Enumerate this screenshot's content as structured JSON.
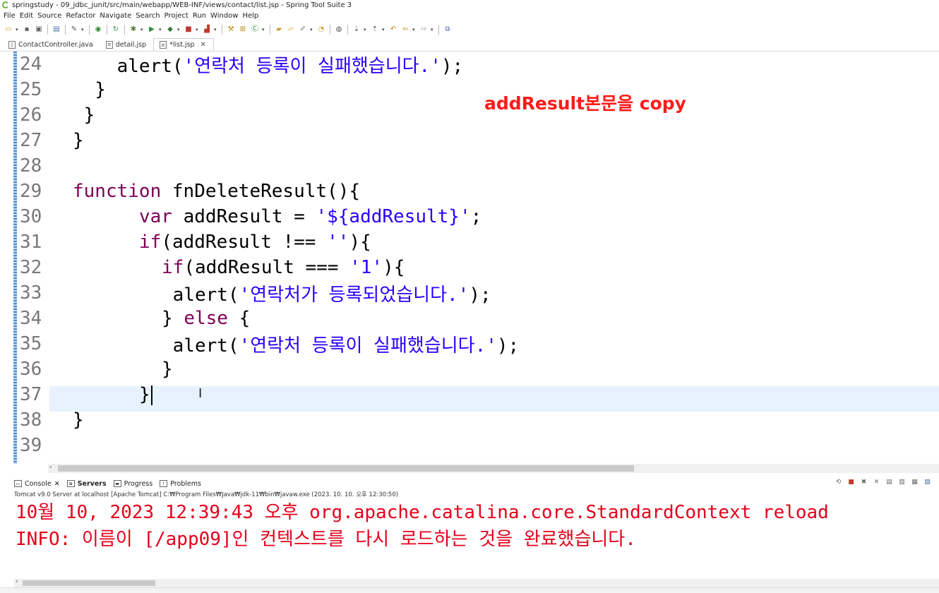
{
  "window": {
    "title": "springstudy - 09_jdbc_junit/src/main/webapp/WEB-INF/views/contact/list.jsp - Spring Tool Suite 3"
  },
  "menu": [
    "File",
    "Edit",
    "Source",
    "Refactor",
    "Navigate",
    "Search",
    "Project",
    "Run",
    "Window",
    "Help"
  ],
  "tabs": [
    {
      "label": "ContactController.java",
      "icon": "java-file-icon"
    },
    {
      "label": "detail.jsp",
      "icon": "jsp-file-icon"
    },
    {
      "label": "*list.jsp",
      "icon": "jsp-file-icon",
      "active": true
    }
  ],
  "editor": {
    "lines": [
      {
        "n": "24",
        "text": "      alert('연락처 등록이 실패했습니다.');"
      },
      {
        "n": "25",
        "text": "    }"
      },
      {
        "n": "26",
        "text": "  }"
      },
      {
        "n": "27",
        "text": "}"
      },
      {
        "n": "28",
        "text": ""
      },
      {
        "n": "29",
        "text": "function fnDeleteResult(){"
      },
      {
        "n": "30",
        "text": "      var addResult = '${addResult}';"
      },
      {
        "n": "31",
        "text": "      if(addResult !== ''){"
      },
      {
        "n": "32",
        "text": "        if(addResult === '1'){"
      },
      {
        "n": "33",
        "text": "          alert('연락처가 등록되었습니다.');"
      },
      {
        "n": "34",
        "text": "        } else {"
      },
      {
        "n": "35",
        "text": "          alert('연락처 등록이 실패했습니다.');"
      },
      {
        "n": "36",
        "text": "        }"
      },
      {
        "n": "37",
        "text": "      }"
      },
      {
        "n": "38",
        "text": "}"
      },
      {
        "n": "39",
        "text": ""
      }
    ],
    "current_line": "37"
  },
  "annotation": "addResult본문을 copy",
  "console": {
    "tabs": [
      {
        "label": "Console",
        "icon": "console-icon",
        "closable": true
      },
      {
        "label": "Servers",
        "icon": "servers-icon",
        "bold": true
      },
      {
        "label": "Progress",
        "icon": "progress-icon"
      },
      {
        "label": "Problems",
        "icon": "problems-icon"
      }
    ],
    "header": "Tomcat v9.0 Server at localhost [Apache Tomcat] C:₩Program Files₩Java₩jdk-11₩bin₩javaw.exe  (2023. 10. 10. 오후 12:30:50)",
    "lines": [
      "10월 10, 2023 12:39:43 오후 org.apache.catalina.core.StandardContext reload",
      "INFO: 이름이 [/app09]인 컨텍스트를 다시 로드하는 것을 완료했습니다."
    ]
  },
  "colors": {
    "keyword": "#7f0055",
    "string": "#2a00ff",
    "annotation": "#ff1a1a",
    "console_text": "#e5001a",
    "line_highlight": "#e8f2fe"
  }
}
